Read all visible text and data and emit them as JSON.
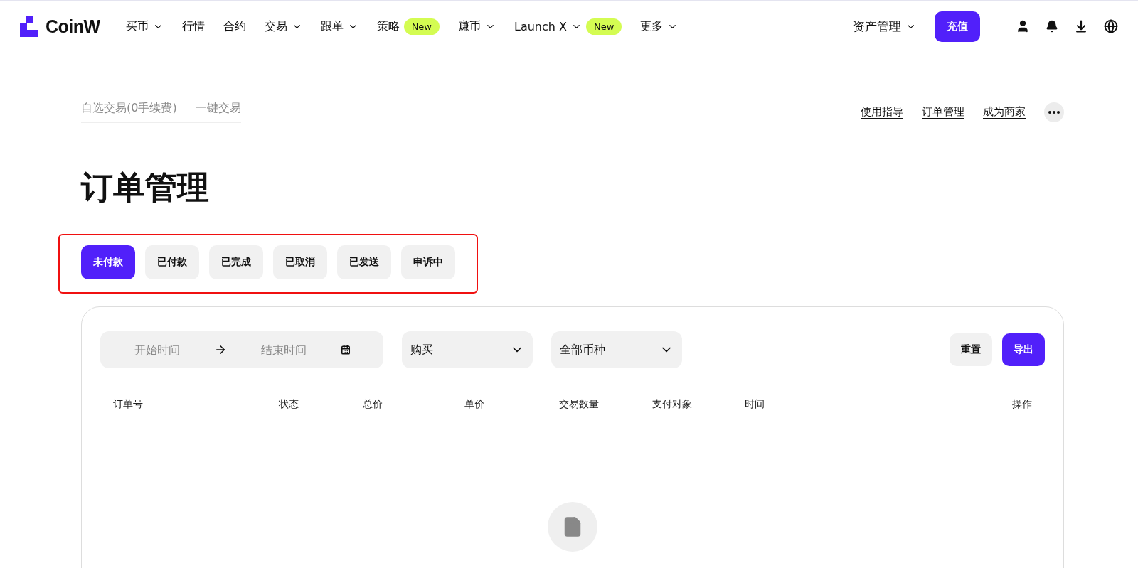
{
  "nav": {
    "logo": "CoinW",
    "items": [
      {
        "label": "买币",
        "dropdown": true
      },
      {
        "label": "行情",
        "dropdown": false
      },
      {
        "label": "合约",
        "dropdown": false
      },
      {
        "label": "交易",
        "dropdown": true
      },
      {
        "label": "跟单",
        "dropdown": true
      },
      {
        "label": "策略",
        "dropdown": false,
        "badge": "New"
      },
      {
        "label": "赚币",
        "dropdown": true
      },
      {
        "label": "Launch X",
        "dropdown": true,
        "badge": "New"
      },
      {
        "label": "更多",
        "dropdown": true
      }
    ],
    "assets": {
      "label": "资产管理",
      "dropdown": true
    },
    "deposit": "充值"
  },
  "subnav": {
    "modes": [
      {
        "label": "自选交易(0手续费)"
      },
      {
        "label": "一键交易"
      }
    ],
    "links": [
      "使用指导",
      "订单管理",
      "成为商家"
    ]
  },
  "title": "订单管理",
  "status_tabs": [
    {
      "label": "未付款",
      "selected": true
    },
    {
      "label": "已付款",
      "selected": false
    },
    {
      "label": "已完成",
      "selected": false
    },
    {
      "label": "已取消",
      "selected": false
    },
    {
      "label": "已发送",
      "selected": false
    },
    {
      "label": "申诉中",
      "selected": false
    }
  ],
  "filters": {
    "start": {
      "placeholder": "开始时间"
    },
    "end": {
      "placeholder": "结束时间"
    },
    "side": "购买",
    "coin": "全部币种",
    "reset": "重置",
    "export": "导出"
  },
  "table": {
    "columns": [
      "订单号",
      "状态",
      "总价",
      "单价",
      "交易数量",
      "支付对象",
      "时间",
      "操作"
    ]
  }
}
